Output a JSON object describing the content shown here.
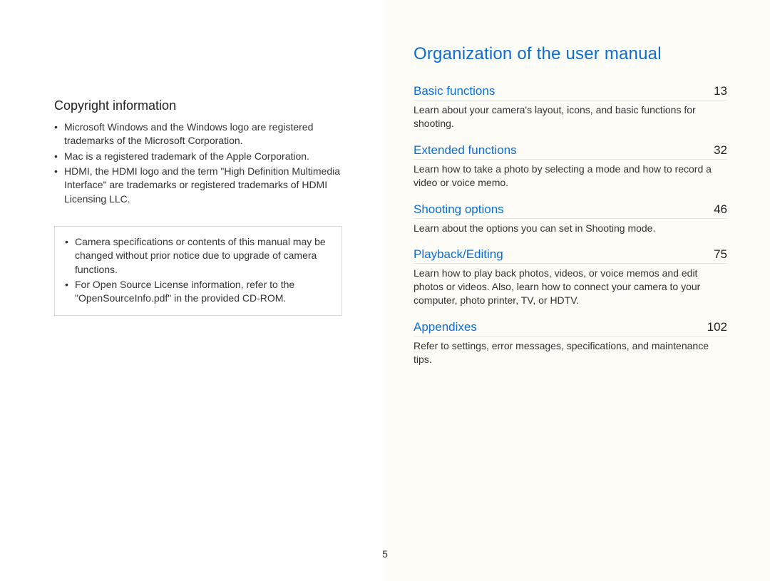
{
  "left": {
    "heading": "Copyright information",
    "bullets": [
      "Microsoft Windows and the Windows logo are registered trademarks of the Microsoft Corporation.",
      "Mac is a registered trademark of the Apple Corporation.",
      "HDMI, the HDMI logo and the term \"High Definition Multimedia Interface\" are trademarks or registered trademarks of HDMI Licensing LLC."
    ],
    "note_bullets": [
      "Camera specifications or contents of this manual may be changed without prior notice due to upgrade of camera functions.",
      "For Open Source License information, refer to the \"OpenSourceInfo.pdf\" in the provided CD-ROM."
    ]
  },
  "right": {
    "title": "Organization of the user manual",
    "toc": [
      {
        "title": "Basic functions",
        "page": "13",
        "desc": "Learn about your camera's layout, icons, and basic functions for shooting."
      },
      {
        "title": "Extended functions",
        "page": "32",
        "desc": "Learn how to take a photo by selecting a mode and how to record a video or voice memo."
      },
      {
        "title": "Shooting options",
        "page": "46",
        "desc": "Learn about the options you can set in Shooting mode."
      },
      {
        "title": "Playback/Editing",
        "page": "75",
        "desc": "Learn how to play back photos, videos, or voice memos and edit photos or videos. Also, learn how to connect your camera to your computer, photo printer, TV, or HDTV."
      },
      {
        "title": "Appendixes",
        "page": "102",
        "desc": "Refer to settings, error messages, specifications, and maintenance tips."
      }
    ]
  },
  "page_number": "5"
}
